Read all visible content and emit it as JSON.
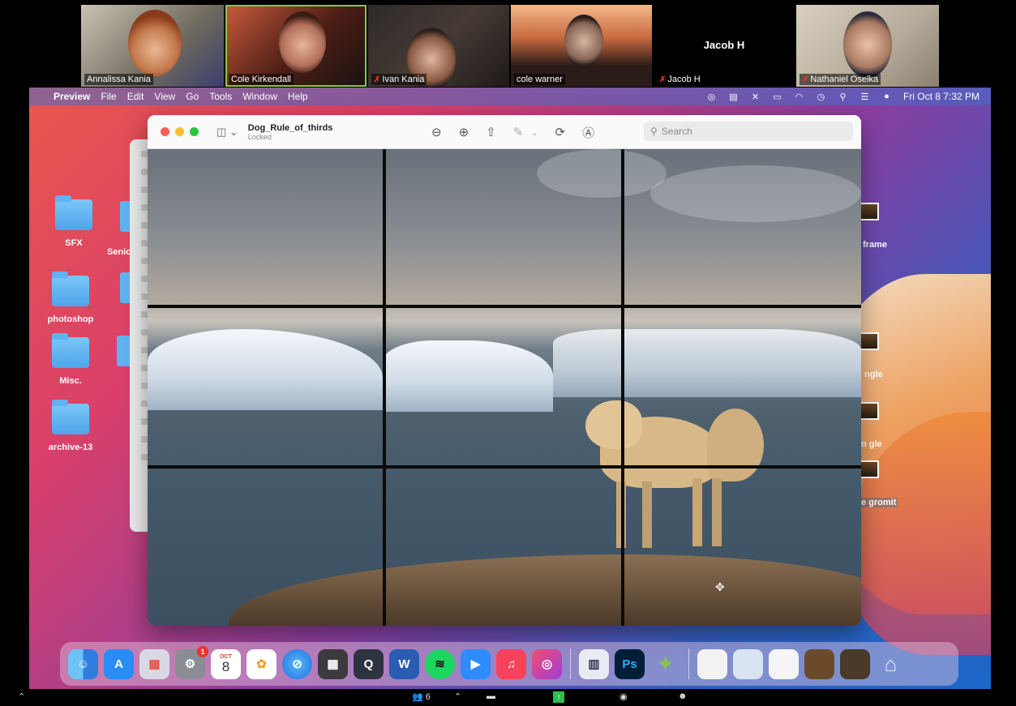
{
  "participants": [
    {
      "name": "Annalissa Kania",
      "muted": false,
      "active": false
    },
    {
      "name": "Cole Kirkendall",
      "muted": false,
      "active": true
    },
    {
      "name": "Ivan Kania",
      "muted": true,
      "active": false
    },
    {
      "name": "cole warner",
      "muted": false,
      "active": false
    },
    {
      "name": "Jacob H",
      "muted": true,
      "active": false,
      "display_name": "Jacob H"
    },
    {
      "name": "Nathaniel Oselka",
      "muted": true,
      "active": false
    }
  ],
  "menubar": {
    "app_name": "Preview",
    "menus": [
      "File",
      "Edit",
      "View",
      "Go",
      "Tools",
      "Window",
      "Help"
    ],
    "clock": "Fri Oct 8  7:32 PM"
  },
  "desktop_icons": [
    "SFX",
    "photoshop",
    "Misc.",
    "archive-13"
  ],
  "partial_labels": {
    "senior": "Senio",
    "right_frame": "frame",
    "right_angle": "ngle",
    "right_angle2": "n gle",
    "right_gromit": "e gromit"
  },
  "preview": {
    "title": "Dog_Rule_of_thirds",
    "subtitle": "Locked",
    "search_placeholder": "Search"
  },
  "dock": {
    "calendar_month": "OCT",
    "calendar_day": "8",
    "settings_badge": "1"
  },
  "zoombar": {
    "participant_count": "6"
  },
  "colors": {
    "zoom_active": "#8cc63f",
    "muted_red": "#e0352f",
    "share_green": "#2ebd4e"
  }
}
